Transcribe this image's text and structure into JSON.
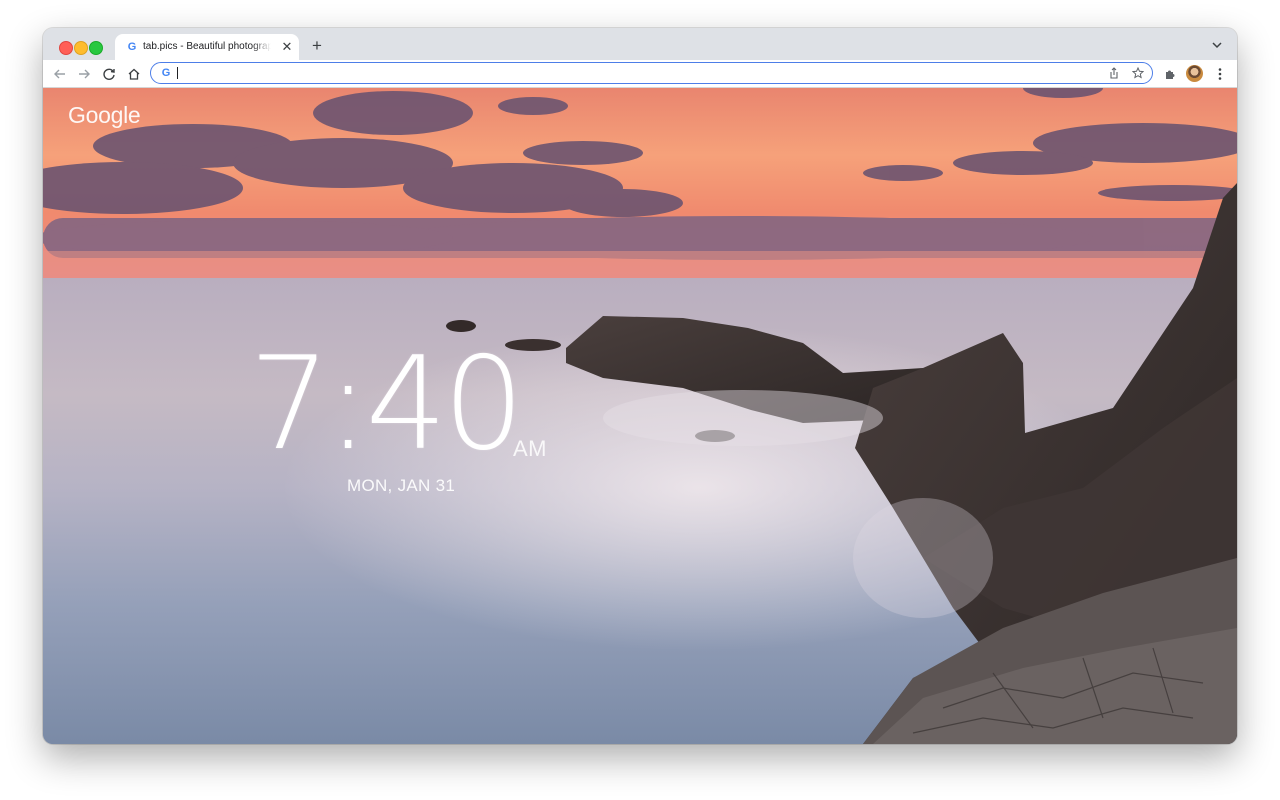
{
  "browser": {
    "tab": {
      "title": "tab.pics - Beautiful photographs",
      "favicon": "google-g-icon"
    },
    "omnibox": {
      "value": "",
      "placeholder": ""
    },
    "accent_color": "#4d7ee8"
  },
  "page": {
    "logo_text": "Google",
    "clock": {
      "time": "7:40",
      "ampm": "AM",
      "date": "MON, JAN 31"
    }
  }
}
